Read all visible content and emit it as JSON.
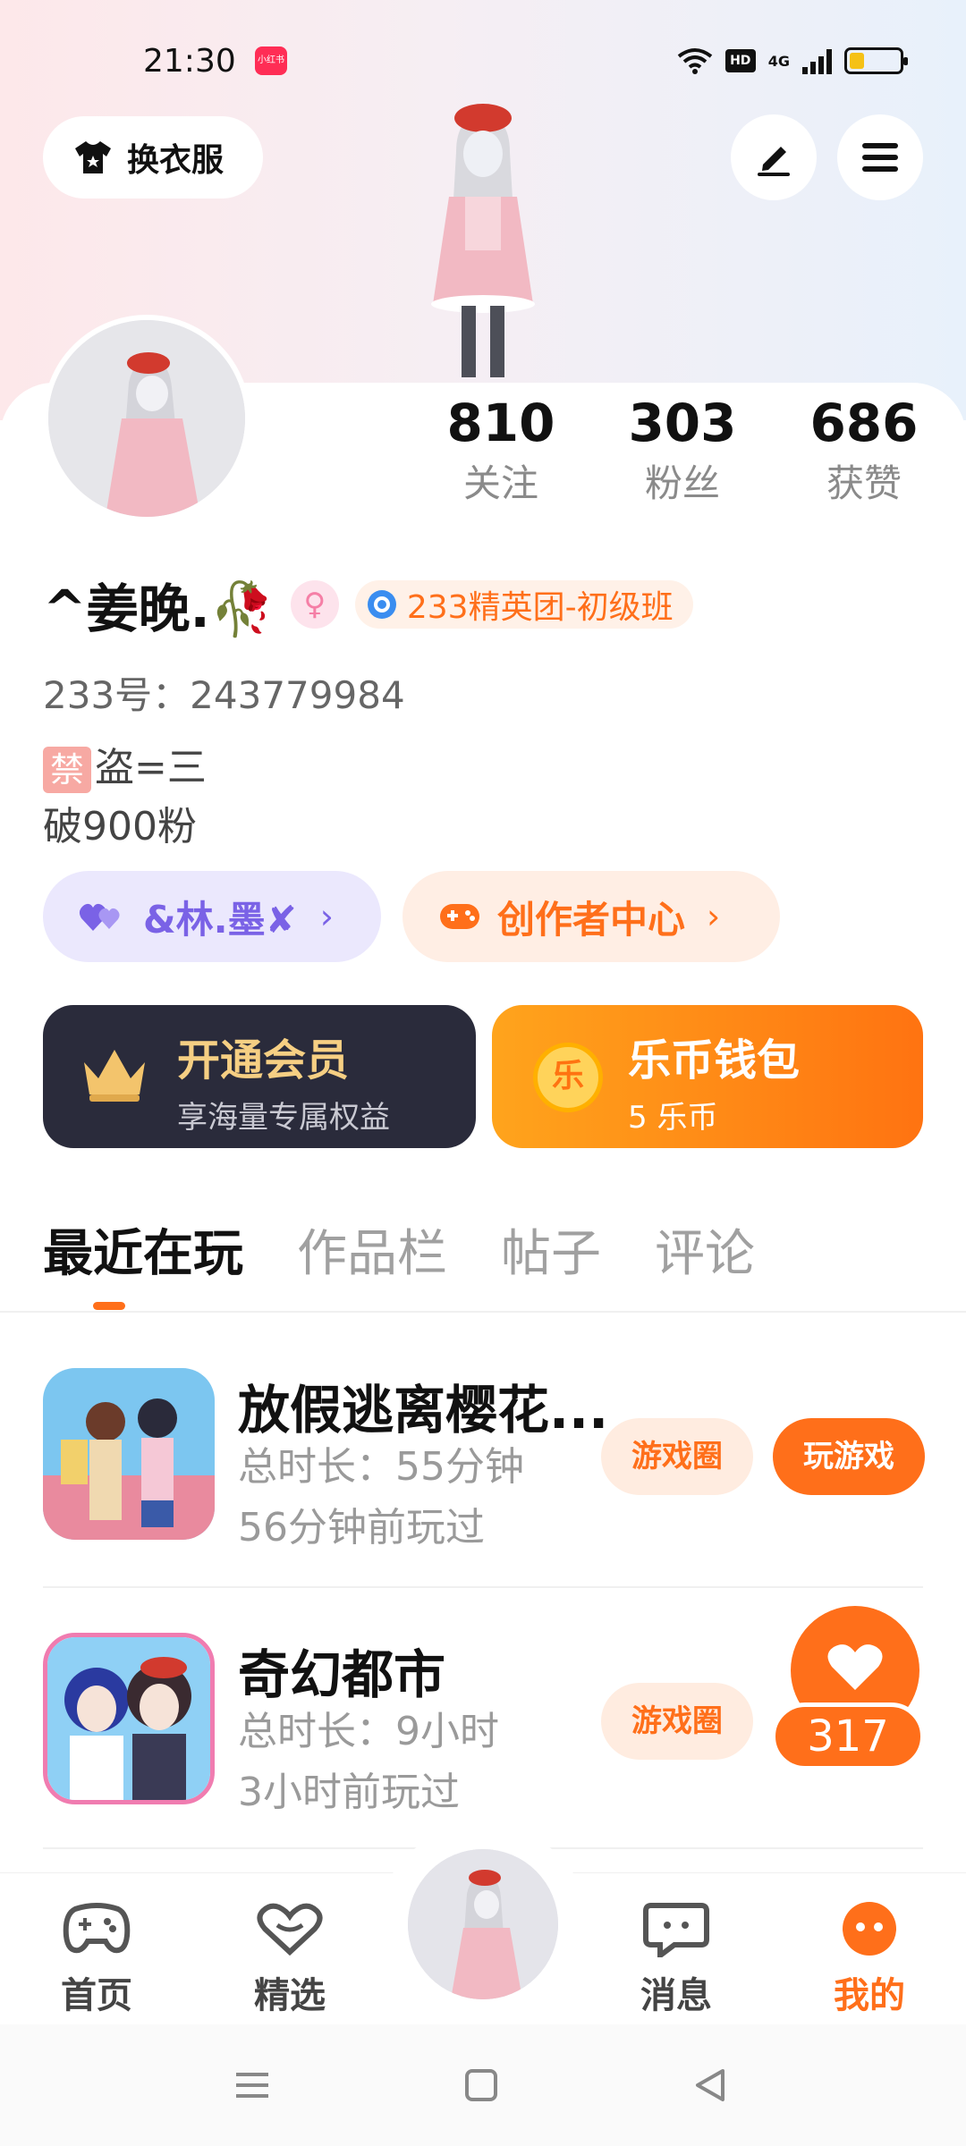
{
  "status_bar": {
    "time": "21:30",
    "notif_badge": "小红书",
    "hd": "HD",
    "network": "4G",
    "battery_level": 0.3
  },
  "header": {
    "outfit_label": "换衣服",
    "edit_icon": "pen-icon",
    "menu_icon": "hamburger-menu-icon"
  },
  "stats": [
    {
      "value": "810",
      "label": "关注"
    },
    {
      "value": "303",
      "label": "粉丝"
    },
    {
      "value": "686",
      "label": "获赞"
    }
  ],
  "profile": {
    "nickname": "^姜晚.🥀",
    "gender_symbol": "♀",
    "group_badge": "233精英团-初级班",
    "uid": "233号：243779984",
    "bio_ban_tag": "禁",
    "bio_line1": "盗=三",
    "bio_line2": "破900粉"
  },
  "pills": {
    "partner": "&林.墨✘",
    "creator": "创作者中心",
    "chevron": "›"
  },
  "promos": {
    "vip_title": "开通会员",
    "vip_sub": "享海量专属权益",
    "wallet_title": "乐币钱包",
    "wallet_sub": "5 乐币",
    "wallet_coin_char": "乐"
  },
  "tabs": [
    "最近在玩",
    "作品栏",
    "帖子",
    "评论"
  ],
  "games": [
    {
      "title": "放假逃离樱花...",
      "duration": "总时长：55分钟",
      "last_played": "56分钟前玩过",
      "circle_btn": "游戏圈",
      "play_btn": "玩游戏"
    },
    {
      "title": "奇幻都市",
      "duration": "总时长：9小时",
      "last_played": "3小时前玩过",
      "circle_btn": "游戏圈"
    }
  ],
  "like_float": {
    "count": "317"
  },
  "bottom_nav": [
    {
      "label": "首页",
      "icon": "gamepad-icon"
    },
    {
      "label": "精选",
      "icon": "heart-chat-icon"
    },
    {
      "label": "消息",
      "icon": "message-icon"
    },
    {
      "label": "我的",
      "icon": "profile-icon"
    }
  ],
  "colors": {
    "accent": "#ff6f1a",
    "partner_purple": "#7a62e6",
    "vip_gold": "#f6cf83",
    "vip_bg": "#2a2b3b"
  }
}
